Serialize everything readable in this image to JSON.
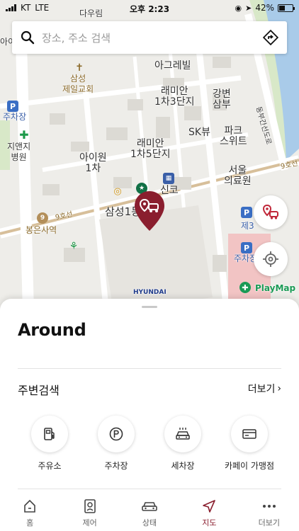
{
  "status_bar": {
    "carrier": "KT",
    "network": "LTE",
    "time": "오후 2:23",
    "battery": "42%",
    "battery_level": 0.42
  },
  "search": {
    "placeholder": "장소, 주소 검색"
  },
  "map": {
    "labels": {
      "dairim": "다우림",
      "agrebil": "아그레빌",
      "samsung_church": "삼성\n제일교회",
      "ramian3": "래미안\n1차3단지",
      "gangbyeon": "강변\n삼부",
      "parking_left": "주차장",
      "jiaenji": "지앤지\n병원",
      "skview": "SK뷰",
      "park_suite": "파크\n스위트",
      "aiwon": "아이원\n1차",
      "ramian5": "래미안\n1차5단지",
      "seoul_clinic": "서울\n의료원",
      "shinko": "신코",
      "samsung1dong": "삼성1동",
      "bongeunsa": "봉은사역",
      "road_9": "9호선",
      "road_9b": "9호선",
      "olympic": "동부간선도로",
      "je3": "제3",
      "parking_right": "주차장",
      "playmap": "PlayMap",
      "hyundai": "HYUNDAI",
      "top_left": "아이"
    }
  },
  "sheet": {
    "title": "Around",
    "section_title": "주변검색",
    "more_label": "더보기",
    "categories": [
      {
        "label": "주유소",
        "icon": "gas-station-icon"
      },
      {
        "label": "주차장",
        "icon": "parking-icon"
      },
      {
        "label": "세차장",
        "icon": "car-wash-icon"
      },
      {
        "label": "카페이 가맹점",
        "icon": "card-icon"
      }
    ]
  },
  "tabs": [
    {
      "label": "홈",
      "icon": "home-icon"
    },
    {
      "label": "제어",
      "icon": "remote-control-icon"
    },
    {
      "label": "상태",
      "icon": "car-status-icon"
    },
    {
      "label": "지도",
      "icon": "navigation-icon",
      "active": true
    },
    {
      "label": "더보기",
      "icon": "more-dots-icon"
    }
  ],
  "colors": {
    "accent": "#8a1e2e",
    "map_bg": "#ecebe7",
    "river": "#9fc4e8",
    "metro": "#b38f5a"
  }
}
